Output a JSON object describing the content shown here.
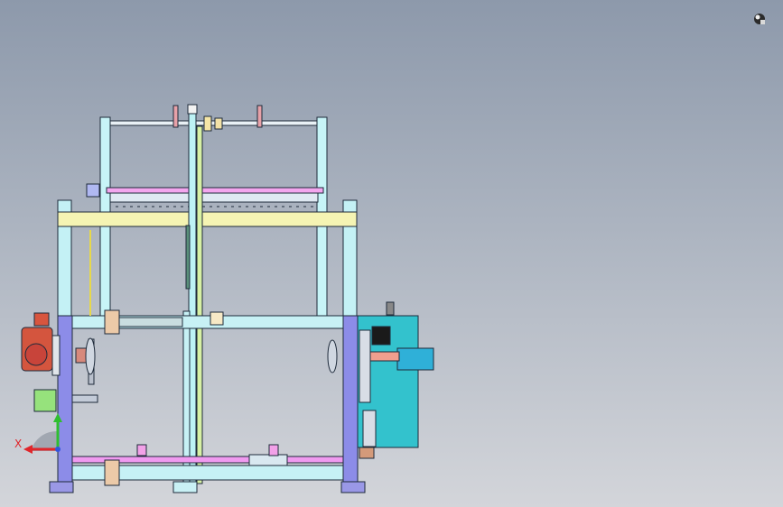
{
  "viewport": {
    "background_top": "#8d99ab",
    "background_bottom": "#d3d5da"
  },
  "triad": {
    "x_label": "X",
    "x_color": "#e0262b",
    "y_color": "#2fbf2f",
    "z_color": "#3355dd"
  },
  "view_orientation": {
    "icon": "view-cube-icon"
  },
  "colors": {
    "frame_cyan": "#bff4f6",
    "frame_purple": "#8f8fe6",
    "beam_yellow": "#f5f4b0",
    "rod_pink": "#f08cf0",
    "panel_teal": "#35c3cd",
    "motor_red": "#d8553e",
    "motor_green": "#8fe07a"
  }
}
